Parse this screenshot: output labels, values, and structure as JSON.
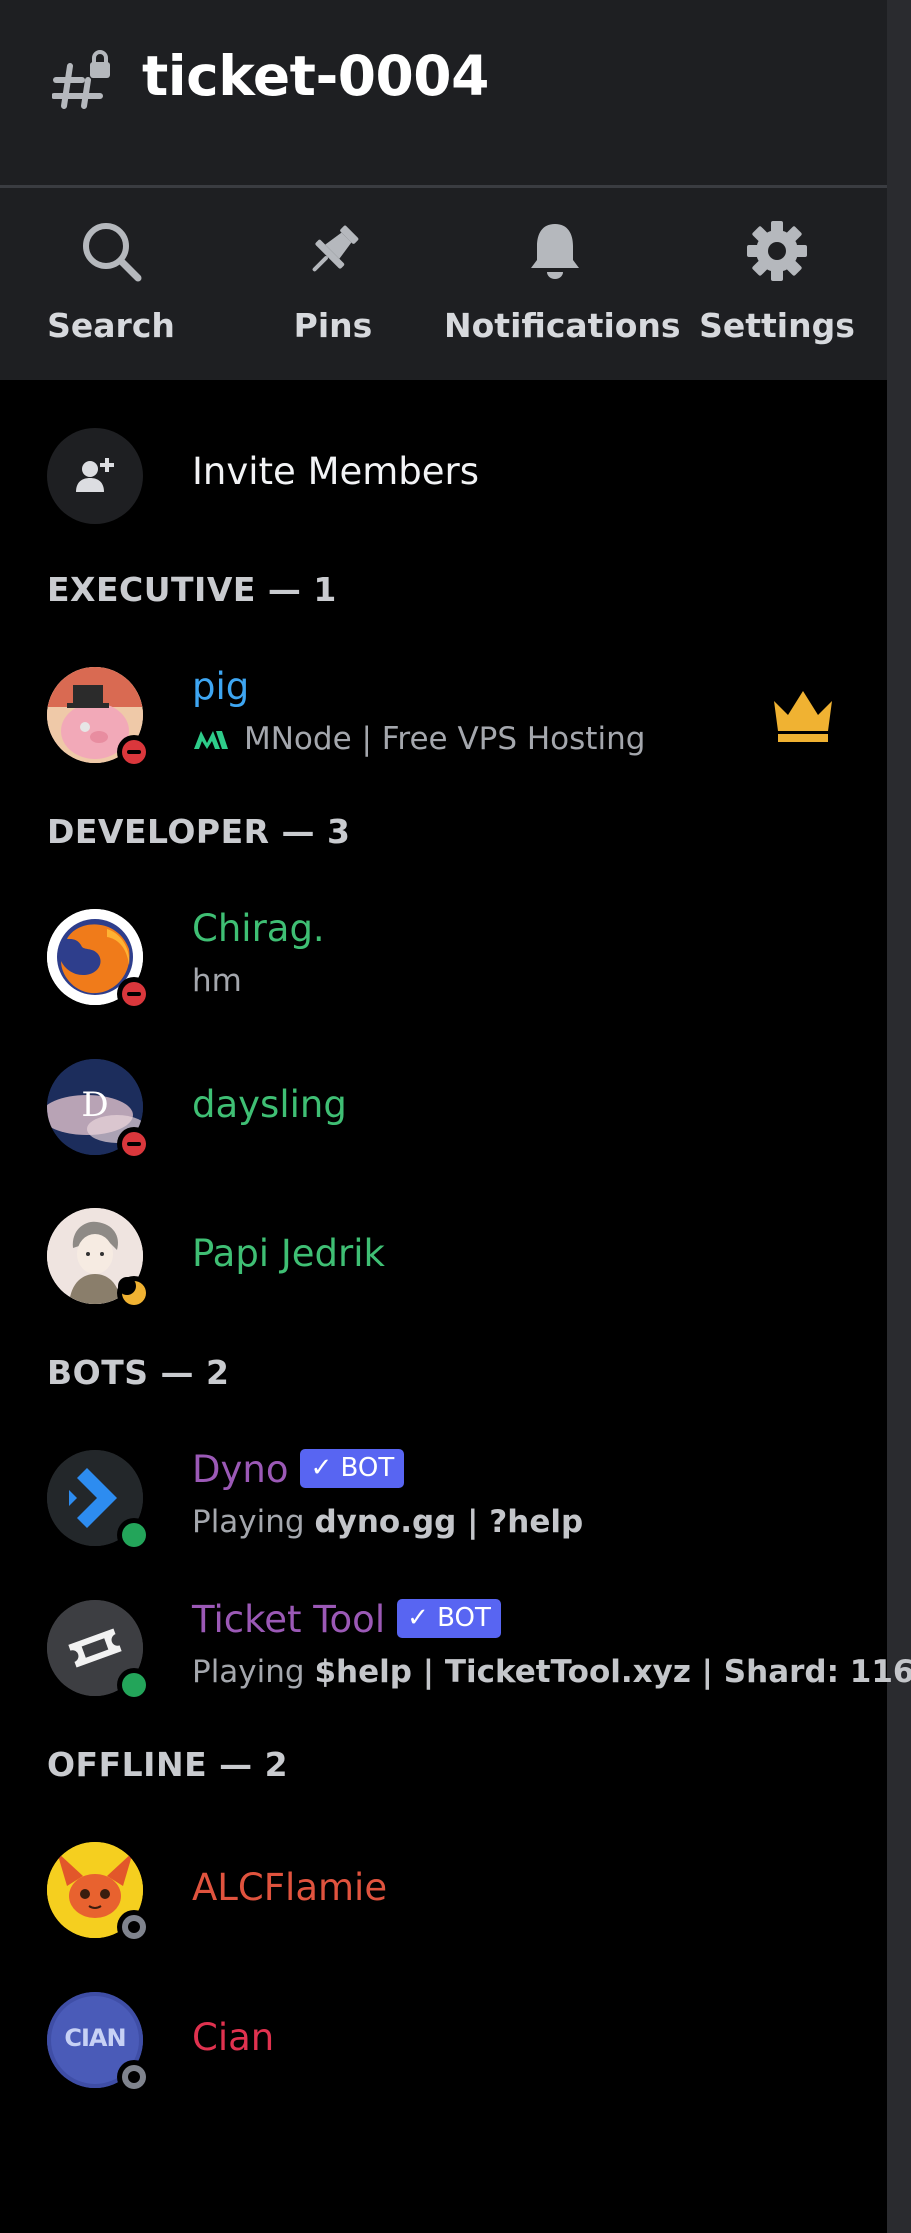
{
  "channel": {
    "name": "ticket-0004"
  },
  "toolbar": {
    "search_label": "Search",
    "pins_label": "Pins",
    "notifications_label": "Notifications",
    "settings_label": "Settings"
  },
  "invite": {
    "label": "Invite Members"
  },
  "sections": {
    "executive": "EXECUTIVE — 1",
    "developer": "DEVELOPER — 3",
    "bots": "BOTS — 2",
    "offline": "OFFLINE — 2"
  },
  "members": {
    "pig": {
      "name": "pig",
      "status_text": "MNode | Free VPS Hosting",
      "status": "dnd",
      "color": "#3ea6f2"
    },
    "chirag": {
      "name": "Chirag.",
      "status_text": "hm",
      "status": "dnd",
      "color": "#3fbf74"
    },
    "daysling": {
      "name": "daysling",
      "status": "dnd",
      "color": "#3fbf74",
      "avatar_letter": "D"
    },
    "papi": {
      "name": "Papi Jedrik",
      "status": "idle",
      "color": "#3fbf74"
    },
    "dyno": {
      "name": "Dyno",
      "tag": "✓ BOT",
      "activity_prefix": "Playing",
      "activity": "dyno.gg | ?help",
      "status": "online",
      "color": "#9b59b6"
    },
    "tickettool": {
      "name": "Ticket Tool",
      "tag": "✓ BOT",
      "activity_prefix": "Playing",
      "activity": "$help | TicketTool.xyz | Shard: 116",
      "status": "online",
      "color": "#9b59b6"
    },
    "alcflamie": {
      "name": "ALCFlamie",
      "status": "offline",
      "color": "#e0533e"
    },
    "cian": {
      "name": "Cian",
      "status": "offline",
      "color": "#e0324f",
      "avatar_text": "CIAN"
    }
  },
  "colors": {
    "background": "#000000",
    "header_bg": "#1e1f22",
    "brand_blurple": "#5865f2",
    "crown": "#f0b232"
  }
}
